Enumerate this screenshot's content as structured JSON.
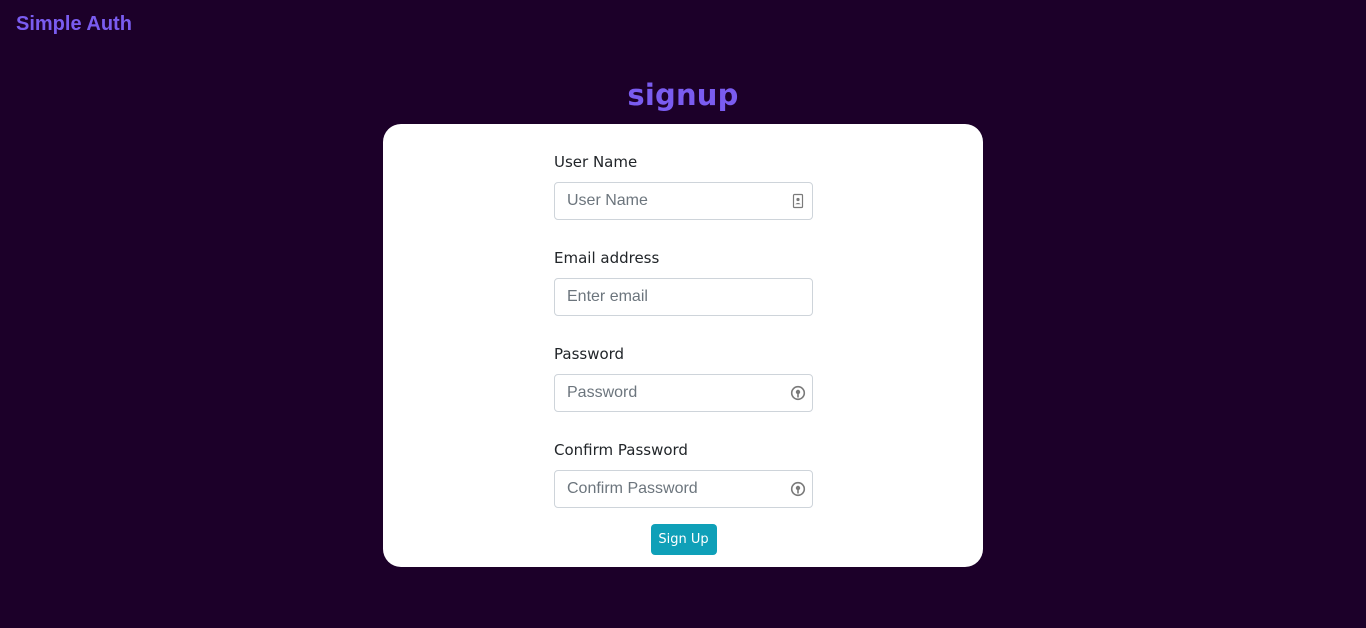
{
  "app": {
    "brand": "Simple Auth"
  },
  "page": {
    "title": "signup"
  },
  "form": {
    "username": {
      "label": "User Name",
      "placeholder": "User Name",
      "icon": "contact-card-icon"
    },
    "email": {
      "label": "Email address",
      "placeholder": "Enter email"
    },
    "password": {
      "label": "Password",
      "placeholder": "Password",
      "icon": "password-manager-icon"
    },
    "confirm_password": {
      "label": "Confirm Password",
      "placeholder": "Confirm Password",
      "icon": "password-manager-icon"
    },
    "submit_label": "Sign Up"
  },
  "colors": {
    "background": "#1c0029",
    "accent": "#7a5cf0",
    "button": "#0fa0b8",
    "card": "#ffffff"
  }
}
